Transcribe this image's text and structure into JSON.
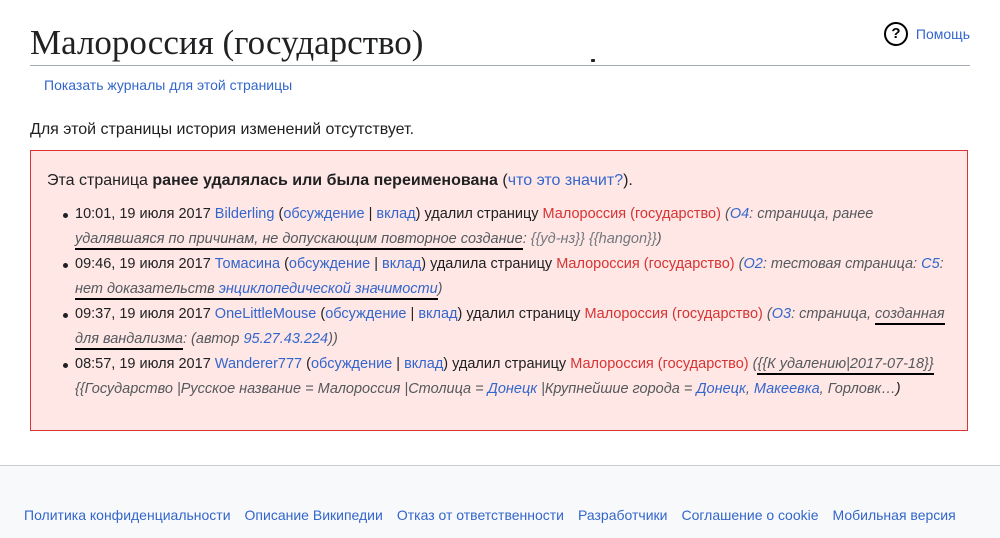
{
  "header": {
    "title": "Малороссия (государство)",
    "help_label": "Помощь",
    "help_icon": "question-circle-icon"
  },
  "logs_link": "Показать журналы для этой страницы",
  "no_history_text": "Для этой страницы история изменений отсутствует.",
  "deletion_box": {
    "intro_prefix": "Эта страница ",
    "intro_bold": "ранее удалялась или была переименована",
    "intro_paren_open": " (",
    "intro_link": "что это значит?",
    "intro_paren_close": ").",
    "entries": [
      {
        "time": "10:01, 19 июля 2017",
        "user": "Bilderling",
        "talk": "обсуждение",
        "sep": " | ",
        "contribs": "вклад",
        "action": "удалил страницу",
        "page": "Малороссия (государство)",
        "reason_code": "О4",
        "reason_text_1": ": страница, ранее ",
        "reason_underlined": "удалявшаяся по причинам, не допускающим повторное создание",
        "reason_text_2": ": ",
        "reason_templates": "{{уд-нз}} {{hangon}}",
        "reason_end": ")"
      },
      {
        "time": "09:46, 19 июля 2017",
        "user": "Томасина",
        "talk": "обсуждение",
        "sep": " | ",
        "contribs": "вклад",
        "action": "удалила страницу",
        "page": "Малороссия (государство)",
        "reason_code": "О2",
        "reason_text_1": ": тестовая страница: ",
        "reason_code_2": "С5",
        "reason_text_2": ": ",
        "reason_underlined_1": "нет доказательств ",
        "reason_underlined_link": "энциклопедической значимости",
        "reason_end": ")"
      },
      {
        "time": "09:37, 19 июля 2017",
        "user": "OneLittleMouse",
        "talk": "обсуждение",
        "sep": " | ",
        "contribs": "вклад",
        "action": "удалил страницу",
        "page": "Малороссия (государство)",
        "reason_code": "О3",
        "reason_text_1": ": страница, ",
        "reason_underlined": "созданная для вандализма",
        "reason_text_2": ": (автор ",
        "reason_ip": "95.27.43.224",
        "reason_end": "))"
      },
      {
        "time": "08:57, 19 июля 2017",
        "user": "Wanderer777",
        "talk": "обсуждение",
        "sep": " | ",
        "contribs": "вклад",
        "action": "удалил страницу",
        "page": "Малороссия (государство)",
        "reason_underlined": "{{К удалению|2017-07-18}}",
        "reason_text_1": " {{Государство |Русское название = Малороссия |Столица = ",
        "reason_link_1": "Донецк",
        "reason_text_2": " |Крупнейшие города = ",
        "reason_link_2": "Донецк",
        "reason_text_3": ", ",
        "reason_link_3": "Макеевка",
        "reason_text_4": ", Горловк…",
        "reason_end": ")"
      }
    ]
  },
  "footer": {
    "links": [
      "Политика конфиденциальности",
      "Описание Википедии",
      "Отказ от ответственности",
      "Разработчики",
      "Соглашение о cookie",
      "Мобильная версия"
    ]
  }
}
